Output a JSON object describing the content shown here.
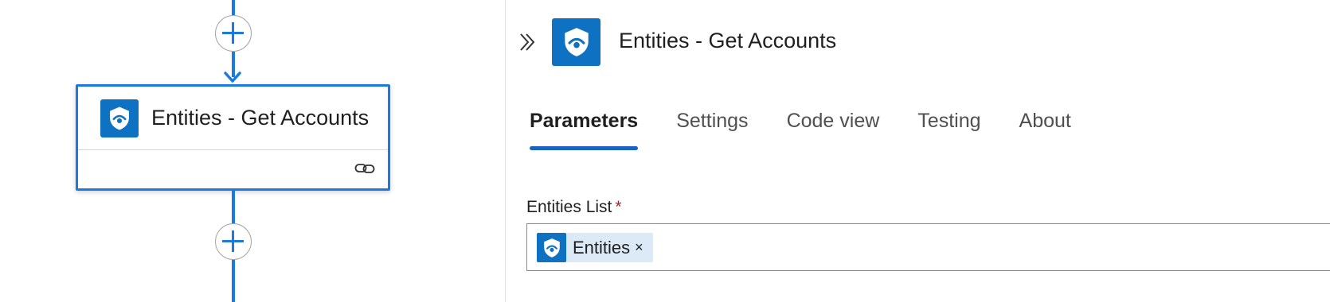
{
  "canvas": {
    "action_card": {
      "title": "Entities - Get Accounts",
      "icon": "sentinel-shield-icon",
      "footer_icon": "link-icon"
    },
    "add_buttons": [
      "plus-icon",
      "plus-icon"
    ]
  },
  "panel": {
    "collapse_icon": "double-chevron-right-icon",
    "title": "Entities - Get Accounts",
    "tabs": [
      {
        "label": "Parameters",
        "active": true
      },
      {
        "label": "Settings",
        "active": false
      },
      {
        "label": "Code view",
        "active": false
      },
      {
        "label": "Testing",
        "active": false
      },
      {
        "label": "About",
        "active": false
      }
    ],
    "field": {
      "label": "Entities List",
      "required_marker": "*",
      "token": {
        "label": "Entities",
        "remove": "×"
      }
    }
  },
  "colors": {
    "accent": "#1a7ae0",
    "brand_icon_bg": "#0f71c2",
    "token_bg": "#dce9f6",
    "required": "#a4262c"
  }
}
